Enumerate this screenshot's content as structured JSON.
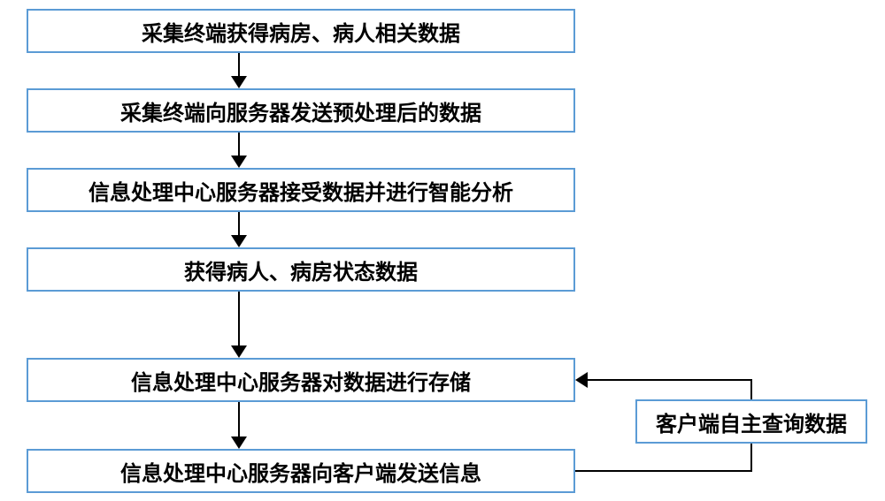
{
  "steps": [
    "采集终端获得病房、病人相关数据",
    "采集终端向服务器发送预处理后的数据",
    "信息处理中心服务器接受数据并进行智能分析",
    "获得病人、病房状态数据",
    "信息处理中心服务器对数据进行存储",
    "信息处理中心服务器向客户端发送信息"
  ],
  "side_step": "客户端自主查询数据"
}
